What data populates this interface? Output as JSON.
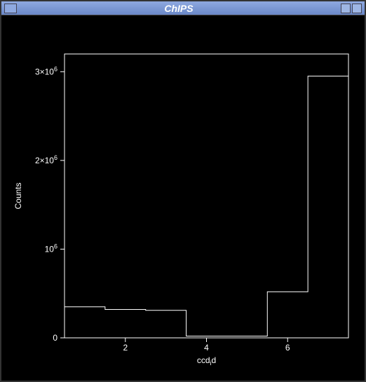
{
  "window": {
    "title": "ChIPS"
  },
  "chart_data": {
    "type": "bar",
    "title": "",
    "xlabel": "ccd_id",
    "ylabel": "Counts",
    "xlim": [
      0.5,
      7.5
    ],
    "ylim": [
      0,
      3200000
    ],
    "xticks": [
      2,
      4,
      6
    ],
    "yticks": [
      0,
      1000000,
      2000000,
      3000000
    ],
    "ytick_labels": [
      "0",
      "10^6",
      "2×10^6",
      "3×10^6"
    ],
    "categories": [
      1,
      2,
      3,
      4,
      5,
      6,
      7
    ],
    "values": [
      350000,
      320000,
      310000,
      20000,
      20000,
      520000,
      2950000
    ]
  }
}
